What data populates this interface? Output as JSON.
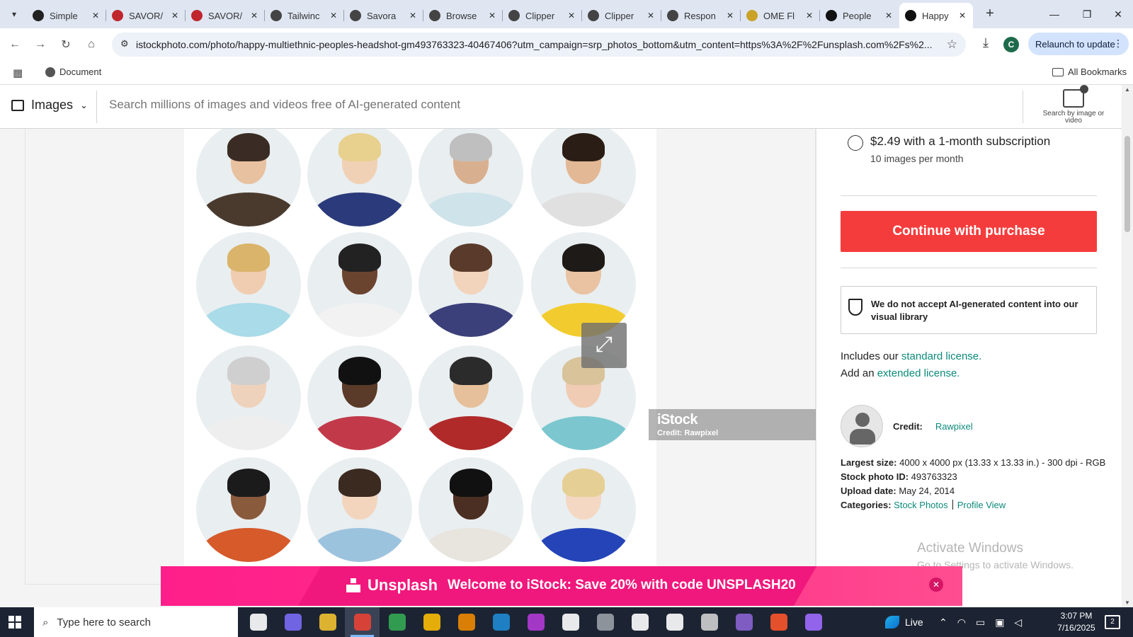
{
  "browser": {
    "tabs": [
      {
        "title": "Simple",
        "favicon": "simple-favicon",
        "color": "#222222"
      },
      {
        "title": "SAVOR/",
        "favicon": "savor-favicon",
        "color": "#c0262d"
      },
      {
        "title": "SAVOR/",
        "favicon": "savor-favicon",
        "color": "#c0262d"
      },
      {
        "title": "Tailwinc",
        "favicon": "globe-favicon",
        "color": "#444444"
      },
      {
        "title": "Savora",
        "favicon": "globe-favicon",
        "color": "#444444"
      },
      {
        "title": "Browse",
        "favicon": "globe-favicon",
        "color": "#444444"
      },
      {
        "title": "Clipper",
        "favicon": "globe-favicon",
        "color": "#444444"
      },
      {
        "title": "Clipper",
        "favicon": "globe-favicon",
        "color": "#444444"
      },
      {
        "title": "Respon",
        "favicon": "globe-favicon",
        "color": "#444444"
      },
      {
        "title": "OME Fl",
        "favicon": "ome-favicon",
        "color": "#c9a227"
      },
      {
        "title": "People",
        "favicon": "unsplash-favicon",
        "color": "#111111"
      },
      {
        "title": "Happy",
        "favicon": "istock-favicon",
        "color": "#111111",
        "active": true
      }
    ],
    "url": "istockphoto.com/photo/happy-multiethnic-peoples-headshot-gm493763323-40467406?utm_campaign=srp_photos_bottom&utm_content=https%3A%2F%2Funsplash.com%2Fs%2...",
    "profile_initial": "C",
    "relaunch_label": "Relaunch to update",
    "bookmarks": {
      "document": "Document",
      "all": "All Bookmarks"
    }
  },
  "istock": {
    "type_selector": "Images",
    "search_placeholder": "Search millions of images and videos free of AI-generated content",
    "visual_search_label": "Search by image or video"
  },
  "photo": {
    "watermark_logo": "iStock",
    "watermark_credit": "Credit: Rawpixel"
  },
  "purchase": {
    "option_price": "$2.49 with a 1-month subscription",
    "option_sub": "10 images per month",
    "cta": "Continue with purchase",
    "ai_notice": "We do not accept AI-generated content into our visual library",
    "license_line1_prefix": "Includes our ",
    "license_line1_link": "standard license.",
    "license_line2_prefix": "Add an ",
    "license_line2_link": "extended license.",
    "credit_label": "Credit:",
    "credit_name": "Rawpixel",
    "largest_size_label": "Largest size:",
    "largest_size_value": "4000 x 4000 px (13.33 x 13.33 in.) - 300 dpi - RGB",
    "stock_id_label": "Stock photo ID:",
    "stock_id_value": "493763323",
    "upload_label": "Upload date:",
    "upload_value": "May 24, 2014",
    "categories_label": "Categories:",
    "categories": [
      "Stock Photos",
      "Profile View"
    ]
  },
  "activate_windows": {
    "line1": "Activate Windows",
    "line2": "Go to Settings to activate Windows."
  },
  "banner": {
    "brand": "Unsplash",
    "promo": "Welcome to iStock: Save 20% with code UNSPLASH20"
  },
  "taskbar": {
    "search_placeholder": "Type here to search",
    "live_label": "Live",
    "time": "3:07 PM",
    "date": "7/16/2025",
    "notification_count": "2"
  },
  "colors": {
    "accent": "#f53c3c",
    "link": "#0c8a7b",
    "banner": "#ff1f8a"
  }
}
